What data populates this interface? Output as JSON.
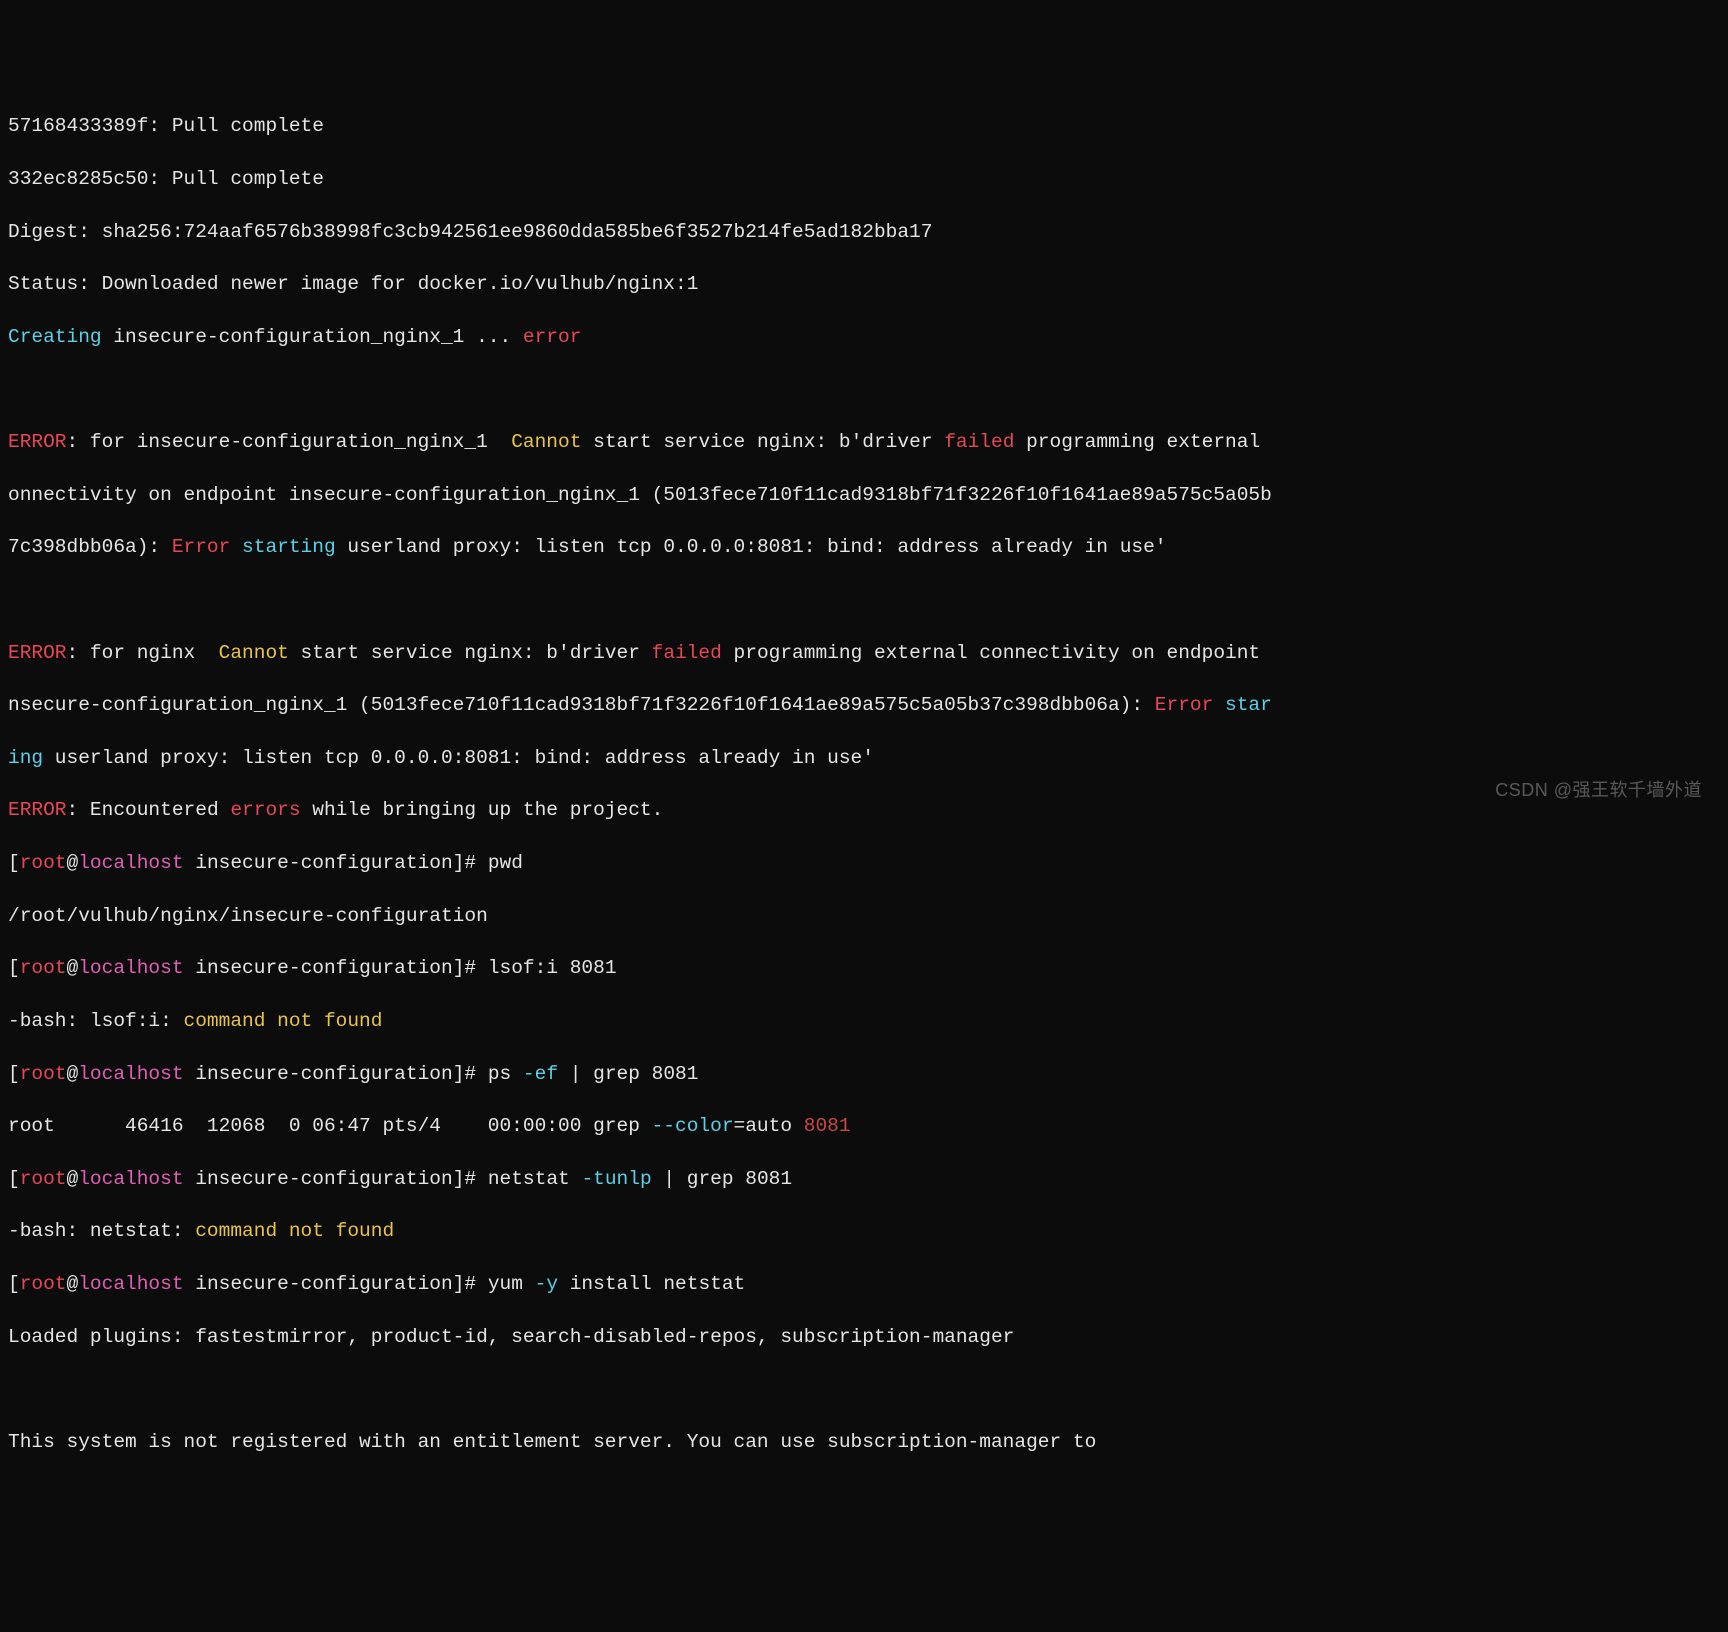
{
  "lines": {
    "l01": "57168433389f: Pull complete",
    "l02": "332ec8285c50: Pull complete",
    "l03": "Digest: sha256:724aaf6576b38998fc3cb942561ee9860dda585be6f3527b214fe5ad182bba17",
    "l04": "Status: Downloaded newer image for docker.io/vulhub/nginx:1"
  },
  "creating": {
    "label": "Creating",
    "name": " insecure-configuration_nginx_1 ... ",
    "status": "error"
  },
  "err1": {
    "prefix": "ERROR",
    "msg1": ": for insecure-configuration_nginx_1  ",
    "cannot": "Cannot",
    "msg2": " start service nginx: b'driver ",
    "failed": "failed",
    "msg3": " programming external ",
    "wrap1": "onnectivity on endpoint insecure-configuration_nginx_1 (5013fece710f11cad9318bf71f3226f10f1641ae89a575c5a05b",
    "wrap2a": "7c398dbb06a): ",
    "error": "Error",
    "sp": " ",
    "starting": "starting",
    "wrap2b": " userland proxy: listen tcp 0.0.0.0:8081: bind: address already in use'"
  },
  "err2": {
    "prefix": "ERROR",
    "msg1": ": for nginx  ",
    "cannot": "Cannot",
    "msg2": " start service nginx: b'driver ",
    "failed": "failed",
    "msg3": " programming external connectivity on endpoint ",
    "wrap1a": "nsecure-configuration_nginx_1 (5013fece710f11cad9318bf71f3226f10f1641ae89a575c5a05b37c398dbb06a): ",
    "error": "Error",
    "sp": " ",
    "star": "star",
    "wrap2a": "ing",
    "wrap2b": " userland proxy: listen tcp 0.0.0.0:8081: bind: address already in use'"
  },
  "err3": {
    "prefix": "ERROR",
    "a": ": Encountered ",
    "errors": "errors",
    "b": " while bringing up the project."
  },
  "prompts": {
    "lb": "[",
    "user": "root",
    "at": "@",
    "host": "localhost",
    "path": " insecure-configuration",
    "rb": "]# "
  },
  "cmds": {
    "pwd": "pwd",
    "pwd_out": "/root/vulhub/nginx/insecure-configuration",
    "lsof": "lsof:i 8081",
    "lsof_err_a": "-bash: lsof:i: ",
    "lsof_err_b": "command not found",
    "ps_a": "ps ",
    "ps_flag": "-ef",
    "ps_b": " | grep 8081",
    "ps_out_a": "root      46416  12068  0 06:47 pts/4    00:00:00 grep ",
    "ps_out_flag": "--color",
    "ps_out_b": "=auto ",
    "ps_out_port": "8081",
    "ns_a": "netstat ",
    "ns_flag": "-tunlp",
    "ns_b": " | grep 8081",
    "ns_err_a": "-bash: netstat: ",
    "ns_err_b": "command not found",
    "yum_a": "yum ",
    "yum_flag": "-y",
    "yum_b": " install netstat",
    "yum_out": "Loaded plugins: fastestmirror, product-id, search-disabled-repos, subscription-manager",
    "yum_msg": "This system is not registered with an entitlement server. You can use subscription-manager to "
  },
  "watermark": "CSDN @强王软千墙外道"
}
